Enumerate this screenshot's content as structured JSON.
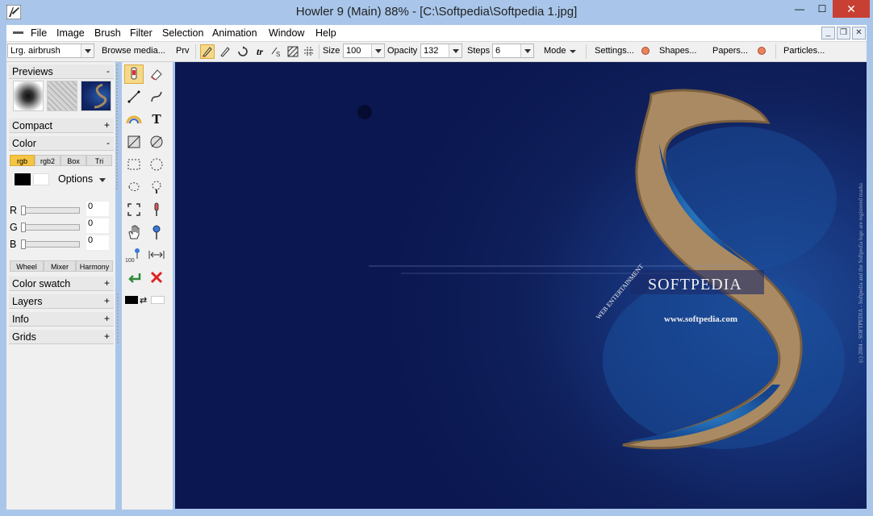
{
  "window": {
    "title": "Howler 9  (Main)   88%   - [C:\\Softpedia\\Softpedia 1.jpg]",
    "min_label": "—",
    "max_label": "☐",
    "close_label": "✕"
  },
  "menu": {
    "items": [
      "File",
      "Image",
      "Brush",
      "Filter",
      "Selection",
      "Animation",
      "Window",
      "Help"
    ],
    "mdi_min": "_",
    "mdi_restore": "❐",
    "mdi_close": "✕"
  },
  "toolbar": {
    "brush_preset": "Lrg. airbrush",
    "browse_label": "Browse media...",
    "prv_label": "Prv",
    "size_label": "Size",
    "size_value": "100",
    "opacity_label": "Opacity",
    "opacity_value": "132",
    "steps_label": "Steps",
    "steps_value": "6",
    "mode_label": "Mode",
    "settings_label": "Settings...",
    "shapes_label": "Shapes...",
    "papers_label": "Papers...",
    "particles_label": "Particles..."
  },
  "panel": {
    "previews_label": "Previews",
    "previews_toggle": "-",
    "compact_label": "Compact",
    "compact_toggle": "+",
    "color_label": "Color",
    "color_toggle": "-",
    "color_tabs": [
      "rgb",
      "rgb2",
      "Box",
      "Tri"
    ],
    "options_label": "Options",
    "r_label": "R",
    "r_value": "0",
    "g_label": "G",
    "g_value": "0",
    "b_label": "B",
    "b_value": "0",
    "mixer_tabs": [
      "Wheel",
      "Mixer",
      "Harmony"
    ],
    "color_swatch_label": "Color swatch",
    "color_swatch_toggle": "+",
    "layers_label": "Layers",
    "layers_toggle": "+",
    "info_label": "Info",
    "info_toggle": "+",
    "grids_label": "Grids",
    "grids_toggle": "+"
  },
  "canvas": {
    "logo_text": "SOFTPEDIA",
    "url_text": "www.softpedia.com",
    "curve_text": "WEB ENTERTAINMENT",
    "side_text": "(c) 2004 - SOFTPEDIA - Softpedia and the Softpedia logo are registered marks"
  },
  "colors": {
    "accent": "#f5c542",
    "close_red": "#c74033",
    "canvas_navy": "#0b1750"
  }
}
